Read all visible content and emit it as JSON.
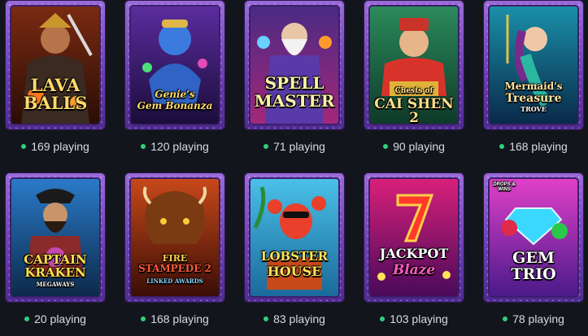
{
  "colors": {
    "background": "#13151c",
    "frame": "#7a4cc4",
    "online_dot": "#2fd17a",
    "text": "#d9dbe2"
  },
  "games": [
    {
      "title_line1": "LAVA",
      "title_line2": "BALLS",
      "players": "169 playing",
      "icon": "warrior-art"
    },
    {
      "title_line1": "Genie's",
      "title_line2": "Gem Bonanza",
      "players": "120 playing",
      "icon": "genie-art"
    },
    {
      "title_line1": "SPELL",
      "title_line2": "MASTER",
      "players": "71 playing",
      "icon": "wizard-art"
    },
    {
      "title_line1": "Chests of",
      "title_line2": "CAI SHEN 2",
      "players": "90 playing",
      "icon": "caishen-art"
    },
    {
      "title_line1": "Mermaid's",
      "title_line2": "Treasure",
      "title_line3": "TROVE",
      "players": "168 playing",
      "icon": "mermaid-art"
    },
    {
      "title_line1": "CAPTAIN",
      "title_line2": "KRAKEN",
      "title_line3": "MEGAWAYS",
      "players": "20 playing",
      "icon": "pirate-art"
    },
    {
      "title_line1": "FIRE",
      "title_line2": "STAMPEDE 2",
      "title_line3": "LINKED AWARDS",
      "players": "168 playing",
      "icon": "bison-art"
    },
    {
      "title_line1": "LOBSTER",
      "title_line2": "HOUSE",
      "players": "83 playing",
      "icon": "lobster-art"
    },
    {
      "title_line1": "JACKPOT",
      "title_line2": "Blaze",
      "players": "103 playing",
      "icon": "seven-art"
    },
    {
      "title_line1": "GEM",
      "title_line2": "TRIO",
      "badge": "DROPS & WINS",
      "players": "78 playing",
      "icon": "gem-art"
    }
  ]
}
